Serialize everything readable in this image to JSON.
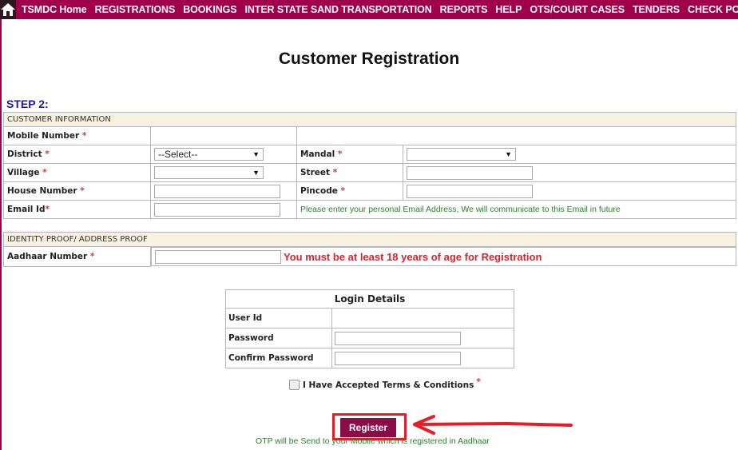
{
  "nav": {
    "home_icon": "home-icon",
    "items": [
      "TSMDC Home",
      "REGISTRATIONS",
      "BOOKINGS",
      "INTER STATE SAND TRANSPORTATION",
      "REPORTS",
      "HELP",
      "OTS/COURT CASES",
      "TENDERS",
      "CHECK POST"
    ]
  },
  "page": {
    "title": "Customer Registration",
    "step": "STEP 2:"
  },
  "customer_info": {
    "header": "CUSTOMER INFORMATION",
    "mobile_label": "Mobile Number",
    "district_label": "District",
    "district_value": "--Select--",
    "mandal_label": "Mandal",
    "mandal_value": "",
    "village_label": "Village",
    "village_value": "",
    "street_label": "Street",
    "house_label": "House Number",
    "pincode_label": "Pincode",
    "email_label": "Email Id",
    "email_hint": "Please enter your personal Email Address, We will communicate to this Email in future",
    "required_mark": "*"
  },
  "identity": {
    "header": "IDENTITY PROOF/ ADDRESS PROOF",
    "aadhaar_label": "Aadhaar Number",
    "age_warning": "You must be at least 18 years of age for Registration"
  },
  "login": {
    "header": "Login Details",
    "userid_label": "User Id",
    "password_label": "Password",
    "confirm_label": "Confirm Password"
  },
  "terms": {
    "label": "I Have Accepted Terms & Conditions",
    "checked": false
  },
  "register": {
    "label": "Register"
  },
  "otp_note": "OTP will be Send to your Mobile which is registered in Aadhaar",
  "colors": {
    "nav_bg": "#a0004a",
    "button_bg": "#8b0a48",
    "highlight": "#e81c24",
    "section_bg": "#f7f1df"
  }
}
